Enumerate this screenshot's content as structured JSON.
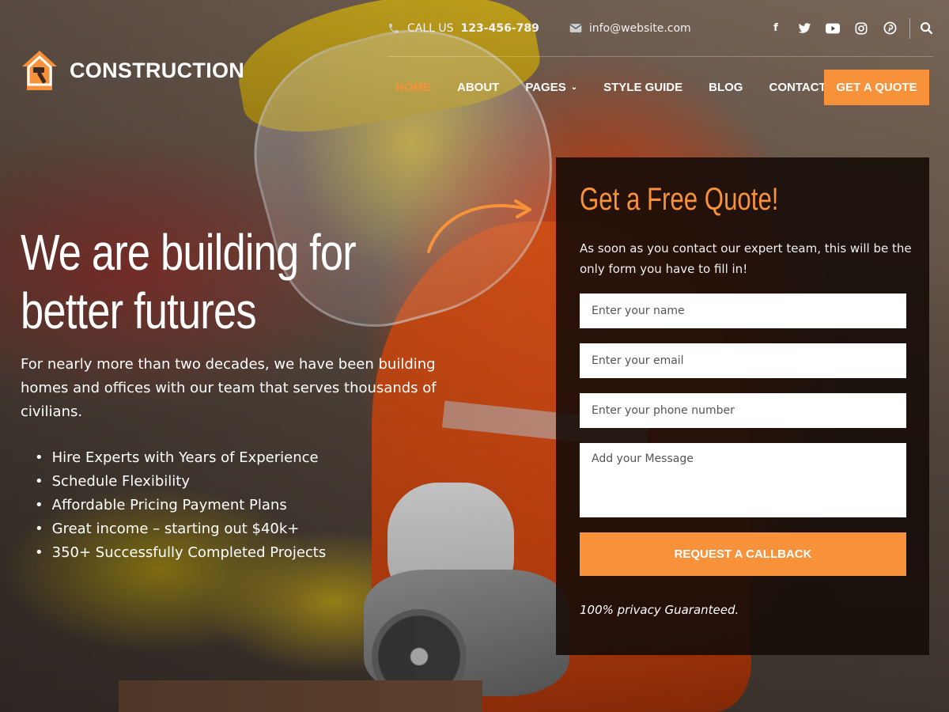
{
  "header": {
    "phone_prefix": "CALL US",
    "phone_number": "123-456-789",
    "email": "info@website.com",
    "social_icons": [
      "facebook-icon",
      "twitter-icon",
      "youtube-icon",
      "instagram-icon",
      "pinterest-icon"
    ],
    "logo_text": "CONSTRUCTION",
    "nav": [
      {
        "label": "HOME",
        "active": true
      },
      {
        "label": "ABOUT",
        "active": false
      },
      {
        "label": "PAGES",
        "active": false,
        "has_dropdown": true
      },
      {
        "label": "STYLE GUIDE",
        "active": false
      },
      {
        "label": "BLOG",
        "active": false
      },
      {
        "label": "CONTACT",
        "active": false
      }
    ],
    "cta_label": "GET A QUOTE"
  },
  "hero": {
    "title_line1": "We are building for",
    "title_line2": "better futures",
    "description": "For nearly more than two decades, we have been building homes and offices with our team that serves thousands of civilians.",
    "benefits": [
      "Hire Experts with Years of Experience",
      "Schedule Flexibility",
      "Affordable Pricing Payment Plans",
      "Great income – starting out $40k+",
      "350+ Successfully Completed Projects"
    ]
  },
  "quote_form": {
    "title": "Get a Free Quote!",
    "intro": "As soon as you contact our expert team, this will be the only form you have to fill in!",
    "name_placeholder": "Enter your name",
    "email_placeholder": "Enter your email",
    "phone_placeholder": "Enter your phone number",
    "message_placeholder": "Add your Message",
    "submit_label": "REQUEST A CALLBACK",
    "privacy_note": "100% privacy Guaranteed."
  },
  "colors": {
    "accent": "#f7923a",
    "form_bg": "#160c08",
    "text_light": "#ffffff"
  }
}
